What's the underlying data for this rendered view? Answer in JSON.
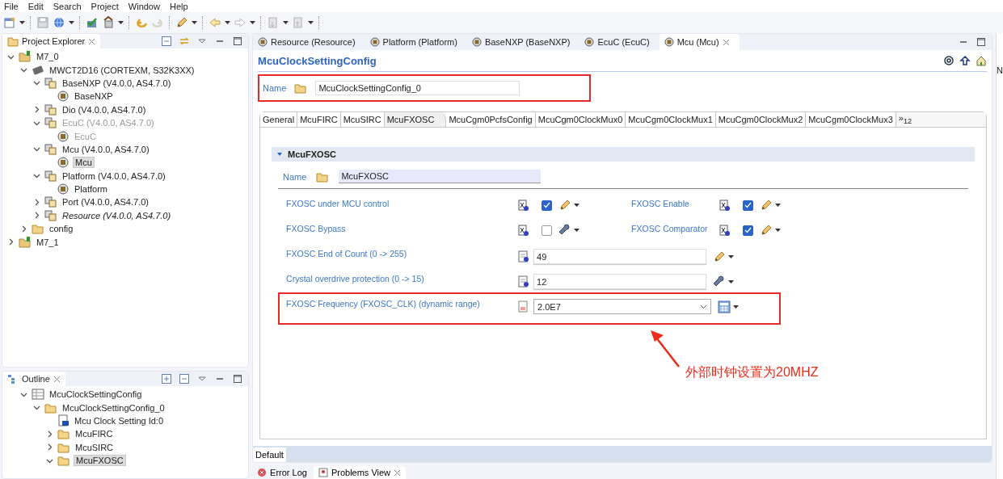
{
  "menu": [
    "File",
    "Edit",
    "Search",
    "Project",
    "Window",
    "Help"
  ],
  "project_explorer": {
    "title": "Project Explorer",
    "tree": [
      {
        "label": "M7_0",
        "kind": "project",
        "expanded": true,
        "selected": false,
        "disabled": false,
        "italic": false,
        "children": [
          {
            "label": "MWCT2D16 (CORTEXM, S32K3XX)",
            "kind": "chip",
            "expanded": true,
            "selected": false,
            "disabled": false,
            "italic": false,
            "children": [
              {
                "label": "BaseNXP (V4.0.0, AS4.7.0)",
                "kind": "module",
                "expanded": true,
                "selected": false,
                "disabled": false,
                "italic": false,
                "children": [
                  {
                    "label": "BaseNXP",
                    "kind": "config",
                    "selected": false,
                    "disabled": false,
                    "italic": false
                  }
                ]
              },
              {
                "label": "Dio (V4.0.0, AS4.7.0)",
                "kind": "module",
                "expanded": false,
                "selected": false,
                "disabled": false,
                "italic": false
              },
              {
                "label": "EcuC (V4.0.0, AS4.7.0)",
                "kind": "module",
                "expanded": true,
                "selected": false,
                "disabled": true,
                "italic": false,
                "children": [
                  {
                    "label": "EcuC",
                    "kind": "config",
                    "selected": false,
                    "disabled": true,
                    "italic": false
                  }
                ]
              },
              {
                "label": "Mcu (V4.0.0, AS4.7.0)",
                "kind": "module",
                "expanded": true,
                "selected": false,
                "disabled": false,
                "italic": false,
                "children": [
                  {
                    "label": "Mcu",
                    "kind": "config",
                    "selected": true,
                    "disabled": false,
                    "italic": false
                  }
                ]
              },
              {
                "label": "Platform (V4.0.0, AS4.7.0)",
                "kind": "module",
                "expanded": true,
                "selected": false,
                "disabled": false,
                "italic": false,
                "children": [
                  {
                    "label": "Platform",
                    "kind": "config",
                    "selected": false,
                    "disabled": false,
                    "italic": false
                  }
                ]
              },
              {
                "label": "Port (V4.0.0, AS4.7.0)",
                "kind": "module",
                "expanded": false,
                "selected": false,
                "disabled": false,
                "italic": false
              },
              {
                "label": "Resource (V4.0.0, AS4.7.0)",
                "kind": "module",
                "expanded": false,
                "selected": false,
                "disabled": false,
                "italic": true
              }
            ]
          },
          {
            "label": "config",
            "kind": "folder",
            "expanded": false,
            "selected": false,
            "disabled": false,
            "italic": false
          }
        ]
      },
      {
        "label": "M7_1",
        "kind": "project",
        "expanded": false,
        "selected": false,
        "disabled": false,
        "italic": false
      }
    ]
  },
  "outline": {
    "title": "Outline",
    "tree": [
      {
        "label": "McuClockSettingConfig",
        "kind": "table",
        "expanded": true,
        "selected": false,
        "children": [
          {
            "label": "McuClockSettingConfig_0",
            "kind": "folder",
            "expanded": true,
            "selected": false,
            "children": [
              {
                "label": "Mcu Clock Setting Id:0",
                "kind": "param",
                "selected": false
              },
              {
                "label": "McuFIRC",
                "kind": "folder",
                "expanded": false,
                "selected": false
              },
              {
                "label": "McuSIRC",
                "kind": "folder",
                "expanded": false,
                "selected": false
              },
              {
                "label": "McuFXOSC",
                "kind": "folder",
                "expanded": true,
                "selected": true
              }
            ]
          }
        ]
      }
    ]
  },
  "editor_tabs": [
    {
      "label": "Resource (Resource)",
      "selected": false
    },
    {
      "label": "Platform (Platform)",
      "selected": false
    },
    {
      "label": "BaseNXP (BaseNXP)",
      "selected": false
    },
    {
      "label": "EcuC (EcuC)",
      "selected": false
    },
    {
      "label": "Mcu (Mcu)",
      "selected": true
    }
  ],
  "editor": {
    "title": "McuClockSettingConfig",
    "name_label": "Name",
    "name_value": "McuClockSettingConfig_0",
    "name_highlighted": true,
    "tabs": [
      {
        "label": "General",
        "selected": false
      },
      {
        "label": "McuFIRC",
        "selected": false
      },
      {
        "label": "McuSIRC",
        "selected": false
      },
      {
        "label": "McuFXOSC",
        "selected": true
      },
      {
        "label": "McuCgm0PcfsConfig",
        "selected": false
      },
      {
        "label": "McuCgm0ClockMux0",
        "selected": false
      },
      {
        "label": "McuCgm0ClockMux1",
        "selected": false
      },
      {
        "label": "McuCgm0ClockMux2",
        "selected": false
      },
      {
        "label": "McuCgm0ClockMux3",
        "selected": false
      }
    ],
    "tabs_overflow": "»$_{12}$",
    "section": {
      "title": "McuFXOSC",
      "expanded": true,
      "name_label": "Name",
      "name_value": "McuFXOSC",
      "rows": [
        {
          "highlighted": false,
          "items": [
            {
              "kind": "checkbox",
              "label": "FXOSC under MCU control",
              "checked": true,
              "action": {
                "kind": "pencil"
              }
            },
            {
              "kind": "checkbox",
              "label": "FXOSC Enable",
              "checked": true,
              "action": {
                "kind": "pencil"
              }
            }
          ]
        },
        {
          "highlighted": false,
          "items": [
            {
              "kind": "checkbox",
              "label": "FXOSC Bypass",
              "checked": false,
              "action": {
                "kind": "wrench"
              }
            },
            {
              "kind": "checkbox",
              "label": "FXOSC Comparator",
              "checked": true,
              "action": {
                "kind": "pencil"
              }
            }
          ]
        },
        {
          "highlighted": false,
          "items": [
            {
              "kind": "text",
              "label": "FXOSC End of Count (0 -> 255)",
              "value": "49",
              "action": {
                "kind": "pencil"
              }
            }
          ]
        },
        {
          "highlighted": false,
          "items": [
            {
              "kind": "text",
              "label": "Crystal overdrive protection (0 -> 15)",
              "value": "12",
              "action": {
                "kind": "wrench"
              }
            }
          ]
        },
        {
          "highlighted": true,
          "items": [
            {
              "kind": "combo",
              "label": "FXOSC Frequency (FXOSC_CLK) (dynamic range)",
              "value": "2.0E7",
              "action": {
                "kind": "calculator"
              }
            }
          ]
        }
      ]
    },
    "annotation": "外部时钟设置为20MHZ",
    "page_tab": "Default"
  },
  "bottom_tabs": [
    {
      "label": "Error Log",
      "selected": false
    },
    {
      "label": "Problems View",
      "selected": true
    }
  ],
  "right_panel_text": "N"
}
